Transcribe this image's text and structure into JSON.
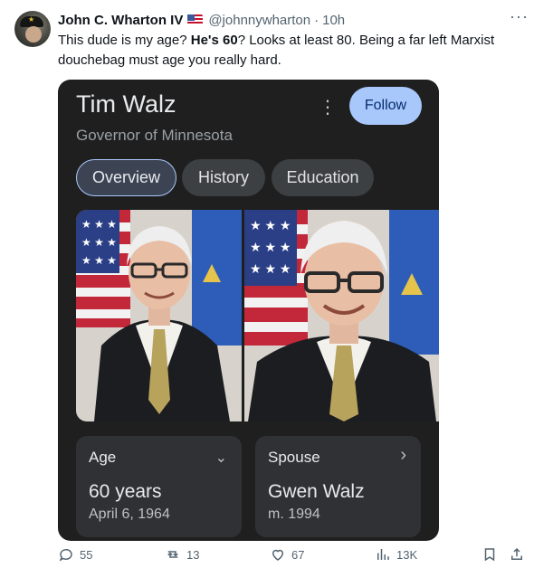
{
  "tweet": {
    "author_name": "John C. Wharton IV",
    "handle": "@johnnywharton",
    "separator": "·",
    "time": "10h",
    "more_label": "···",
    "text_before": "This dude is my age? ",
    "text_bold": "He's 60",
    "text_after": "? Looks at least 80. Being a far left Marxist douchebag must age you really hard."
  },
  "card": {
    "title": "Tim Walz",
    "subtitle": "Governor of Minnesota",
    "kebab_label": "⋮",
    "follow_label": "Follow",
    "tabs": [
      {
        "label": "Overview",
        "active": true
      },
      {
        "label": "History",
        "active": false
      },
      {
        "label": "Education",
        "active": false
      }
    ],
    "stats": [
      {
        "label": "Age",
        "value": "60 years",
        "detail": "April 6, 1964",
        "chevron": "⌄"
      },
      {
        "label": "Spouse",
        "value": "Gwen Walz",
        "detail": "m. 1994",
        "chevron": "›"
      }
    ]
  },
  "actions": {
    "replies": "55",
    "reposts": "13",
    "likes": "67",
    "views": "13K"
  },
  "colors": {
    "card_bg": "#1f1f1f",
    "follow_bg": "#a8c7fa",
    "chip_active_bg": "#3c4454",
    "stat_bg": "#303134",
    "meta_gray": "#536471"
  }
}
